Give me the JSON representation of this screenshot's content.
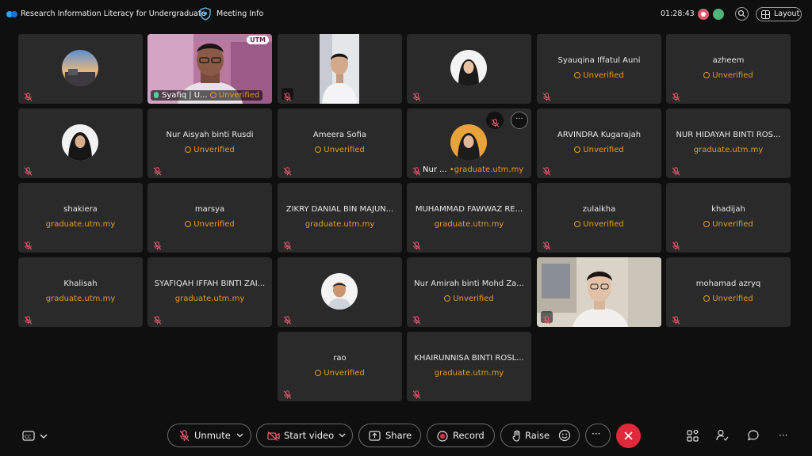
{
  "header": {
    "meeting_title": "Research Information Literacy for Undergraduate",
    "meeting_info_label": "Meeting Info",
    "timer": "01:28:43",
    "layout_label": "Layout"
  },
  "tiles": [
    {
      "name": "",
      "status": ""
    },
    {
      "name": "Syafiq | U...",
      "status": "Unverified",
      "badge": "UTM"
    },
    {
      "name": "",
      "status": ""
    },
    {
      "name": "",
      "status": ""
    },
    {
      "name": "Syauqina Iffatul Auni",
      "status": "Unverified"
    },
    {
      "name": "azheem",
      "status": "Unverified"
    },
    {
      "name": "",
      "status": ""
    },
    {
      "name": "Nur Aisyah binti Rusdi",
      "status": "Unverified"
    },
    {
      "name": "Ameera Sofia",
      "status": "Unverified"
    },
    {
      "name": "Nur ...",
      "status": "graduate.utm.my"
    },
    {
      "name": "ARVINDRA Kugarajah",
      "status": "Unverified"
    },
    {
      "name": "NUR HIDAYAH BINTI ROS...",
      "status": "graduate.utm.my"
    },
    {
      "name": "shakiera",
      "status": "graduate.utm.my"
    },
    {
      "name": "marsya",
      "status": "Unverified"
    },
    {
      "name": "ZIKRY DANIAL BIN MAJUN...",
      "status": "graduate.utm.my"
    },
    {
      "name": "MUHAMMAD FAWWAZ RE...",
      "status": "graduate.utm.my"
    },
    {
      "name": "zulaikha",
      "status": "Unverified"
    },
    {
      "name": "khadijah",
      "status": "Unverified"
    },
    {
      "name": "Khalisah",
      "status": "graduate.utm.my"
    },
    {
      "name": "SYAFIQAH IFFAH BINTI ZAI...",
      "status": "graduate.utm.my"
    },
    {
      "name": "",
      "status": ""
    },
    {
      "name": "Nur Amirah binti Mohd Za...",
      "status": "Unverified"
    },
    {
      "name": "",
      "status": ""
    },
    {
      "name": "mohamad azryq",
      "status": "Unverified"
    },
    {
      "name": "rao",
      "status": "Unverified"
    },
    {
      "name": "KHAIRUNNISA BINTI ROSL...",
      "status": "graduate.utm.my"
    }
  ],
  "controls": {
    "unmute": "Unmute",
    "start_video": "Start video",
    "share": "Share",
    "record": "Record",
    "raise": "Raise",
    "more": "···",
    "overflow": "···"
  },
  "colors": {
    "background": "#0f0f0f",
    "tile": "#2a2a2a",
    "unverified": "#e39a2a",
    "mute_icon": "#e05a6b",
    "leave": "#e0293a",
    "active_speaker": "#2fbfb0"
  }
}
